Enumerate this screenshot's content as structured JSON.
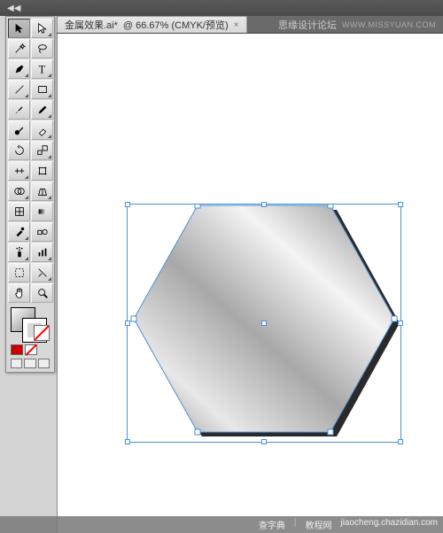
{
  "topbar": {
    "collapse_label": "◀◀"
  },
  "tab": {
    "filename": "金属效果.ai*",
    "zoom_mode": "@ 66.67% (CMYK/预览)",
    "close": "×"
  },
  "header": {
    "site": "思缘设计论坛",
    "watermark": "WWW.MISSYUAN.COM"
  },
  "tools": [
    {
      "name": "selection-tool",
      "icon": "arrow",
      "corner": false,
      "sel": true
    },
    {
      "name": "direct-selection-tool",
      "icon": "arrow-open",
      "corner": true,
      "sel": false
    },
    {
      "name": "magic-wand-tool",
      "icon": "wand",
      "corner": false,
      "sel": false
    },
    {
      "name": "lasso-tool",
      "icon": "lasso",
      "corner": false,
      "sel": false
    },
    {
      "name": "pen-tool",
      "icon": "pen",
      "corner": true,
      "sel": false
    },
    {
      "name": "type-tool",
      "icon": "type",
      "corner": true,
      "sel": false
    },
    {
      "name": "line-tool",
      "icon": "line",
      "corner": true,
      "sel": false
    },
    {
      "name": "rectangle-tool",
      "icon": "rect",
      "corner": true,
      "sel": false
    },
    {
      "name": "paintbrush-tool",
      "icon": "brush",
      "corner": false,
      "sel": false
    },
    {
      "name": "pencil-tool",
      "icon": "pencil",
      "corner": true,
      "sel": false
    },
    {
      "name": "blob-brush-tool",
      "icon": "blob",
      "corner": false,
      "sel": false
    },
    {
      "name": "eraser-tool",
      "icon": "eraser",
      "corner": true,
      "sel": false
    },
    {
      "name": "rotate-tool",
      "icon": "rotate",
      "corner": false,
      "sel": false
    },
    {
      "name": "scale-tool",
      "icon": "scale",
      "corner": true,
      "sel": false
    },
    {
      "name": "width-tool",
      "icon": "width",
      "corner": true,
      "sel": false
    },
    {
      "name": "free-transform-tool",
      "icon": "transform",
      "corner": false,
      "sel": false
    },
    {
      "name": "shape-builder-tool",
      "icon": "shapebuild",
      "corner": true,
      "sel": false
    },
    {
      "name": "perspective-tool",
      "icon": "perspective",
      "corner": true,
      "sel": false
    },
    {
      "name": "mesh-tool",
      "icon": "mesh",
      "corner": false,
      "sel": false
    },
    {
      "name": "gradient-tool",
      "icon": "gradient",
      "corner": false,
      "sel": false
    },
    {
      "name": "eyedropper-tool",
      "icon": "eyedrop",
      "corner": true,
      "sel": false
    },
    {
      "name": "blend-tool",
      "icon": "blend",
      "corner": false,
      "sel": false
    },
    {
      "name": "symbol-sprayer-tool",
      "icon": "spray",
      "corner": true,
      "sel": false
    },
    {
      "name": "graph-tool",
      "icon": "graph",
      "corner": true,
      "sel": false
    },
    {
      "name": "artboard-tool",
      "icon": "artboard",
      "corner": false,
      "sel": false
    },
    {
      "name": "slice-tool",
      "icon": "slice",
      "corner": true,
      "sel": false
    },
    {
      "name": "hand-tool",
      "icon": "hand",
      "corner": false,
      "sel": false
    },
    {
      "name": "zoom-tool",
      "icon": "zoom",
      "corner": false,
      "sel": false
    }
  ],
  "fillstroke": {
    "fill": "linear-gradient",
    "stroke": "none"
  },
  "swatches": {
    "color": "#c00"
  },
  "canvas": {
    "shape": "hexagon",
    "selection_color": "#4a90d9",
    "gradient_colors": [
      "#ffffff",
      "#b8b8b8",
      "#e8e8e8",
      "#909090"
    ]
  },
  "footer": {
    "brand": "查字典",
    "section": "教程网",
    "domain": "jiaocheng.chazidian.com"
  }
}
